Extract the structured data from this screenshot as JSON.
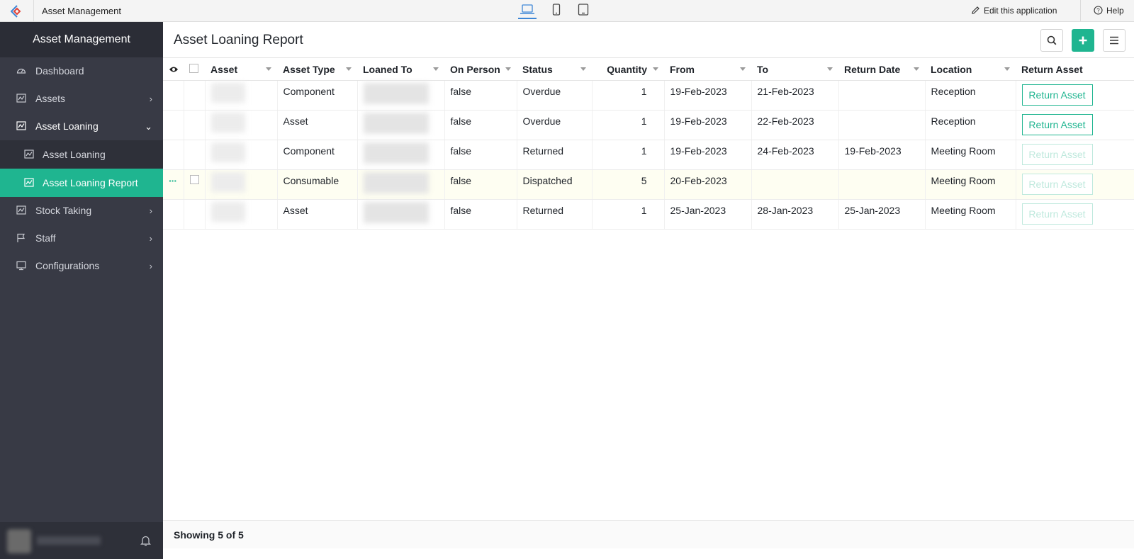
{
  "topbar": {
    "app_title": "Asset Management",
    "edit_label": "Edit this application",
    "help_label": "Help",
    "devices": [
      "laptop-icon",
      "mobile-icon",
      "tablet-icon"
    ],
    "active_device": "laptop-icon"
  },
  "sidebar": {
    "header": "Asset Management",
    "items": [
      {
        "label": "Dashboard",
        "icon": "dashboard-icon"
      },
      {
        "label": "Assets",
        "icon": "chart-icon",
        "expandable": true
      },
      {
        "label": "Asset Loaning",
        "icon": "chart-icon",
        "expanded": true
      },
      {
        "label": "Asset Loaning",
        "icon": "chart-icon",
        "sub": true
      },
      {
        "label": "Asset Loaning Report",
        "icon": "chart-icon",
        "sub": true,
        "active": true
      },
      {
        "label": "Stock Taking",
        "icon": "chart-icon",
        "expandable": true
      },
      {
        "label": "Staff",
        "icon": "flag-icon",
        "expandable": true
      },
      {
        "label": "Configurations",
        "icon": "monitor-icon",
        "expandable": true
      }
    ]
  },
  "main": {
    "title": "Asset Loaning Report",
    "columns": [
      "Asset",
      "Asset Type",
      "Loaned To",
      "On Person",
      "Status",
      "Quantity",
      "From",
      "To",
      "Return Date",
      "Location",
      "Return Asset"
    ],
    "rows": [
      {
        "asset_type": "Component",
        "on_person": "false",
        "status": "Overdue",
        "quantity": "1",
        "from": "19-Feb-2023",
        "to": "21-Feb-2023",
        "return_date": "",
        "location": "Reception",
        "return_label": "Return Asset",
        "return_enabled": true
      },
      {
        "asset_type": "Asset",
        "on_person": "false",
        "status": "Overdue",
        "quantity": "1",
        "from": "19-Feb-2023",
        "to": "22-Feb-2023",
        "return_date": "",
        "location": "Reception",
        "return_label": "Return Asset",
        "return_enabled": true
      },
      {
        "asset_type": "Component",
        "on_person": "false",
        "status": "Returned",
        "quantity": "1",
        "from": "19-Feb-2023",
        "to": "24-Feb-2023",
        "return_date": "19-Feb-2023",
        "location": "Meeting Room",
        "return_label": "Return Asset",
        "return_enabled": false
      },
      {
        "asset_type": "Consumable",
        "on_person": "false",
        "status": "Dispatched",
        "quantity": "5",
        "from": "20-Feb-2023",
        "to": "",
        "return_date": "",
        "location": "Meeting Room",
        "return_label": "Return Asset",
        "return_enabled": false
      },
      {
        "asset_type": "Asset",
        "on_person": "false",
        "status": "Returned",
        "quantity": "1",
        "from": "25-Jan-2023",
        "to": "28-Jan-2023",
        "return_date": "25-Jan-2023",
        "location": "Meeting Room",
        "return_label": "Return Asset",
        "return_enabled": false
      }
    ],
    "footer": "Showing 5 of 5"
  },
  "colors": {
    "accent": "#1fb590",
    "sidebar_bg": "#383a45",
    "sidebar_header": "#2b2d36"
  }
}
